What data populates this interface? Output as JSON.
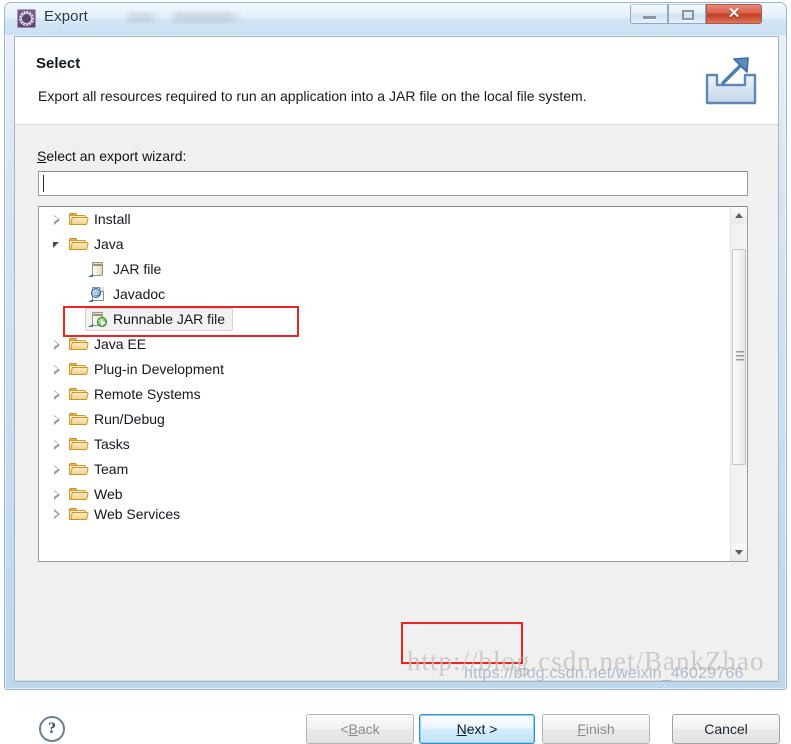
{
  "window": {
    "title": "Export",
    "icon": "eclipse-gear-icon",
    "controls": {
      "minimize": "minimize-button",
      "maximize": "maximize-button",
      "close": "✕"
    }
  },
  "header": {
    "title": "Select",
    "description": "Export all resources required to run an application into a JAR file on the local file system.",
    "icon": "export-wizard-icon"
  },
  "form": {
    "field_label_mnemonic": "S",
    "field_label_rest": "elect an export wizard:",
    "filter_value": "",
    "filter_placeholder": ""
  },
  "tree": {
    "items": [
      {
        "label": "Install",
        "level": 0,
        "icon": "folder-icon",
        "state": "collapsed",
        "selected": false,
        "clipped": false
      },
      {
        "label": "Java",
        "level": 0,
        "icon": "folder-icon",
        "state": "expanded",
        "selected": false,
        "clipped": false
      },
      {
        "label": "JAR file",
        "level": 1,
        "icon": "jar-file-icon",
        "state": "leaf",
        "selected": false,
        "clipped": false
      },
      {
        "label": "Javadoc",
        "level": 1,
        "icon": "javadoc-icon",
        "state": "leaf",
        "selected": false,
        "clipped": false
      },
      {
        "label": "Runnable JAR file",
        "level": 1,
        "icon": "runnable-jar-file-icon",
        "state": "leaf",
        "selected": true,
        "clipped": false
      },
      {
        "label": "Java EE",
        "level": 0,
        "icon": "folder-icon",
        "state": "collapsed",
        "selected": false,
        "clipped": false
      },
      {
        "label": "Plug-in Development",
        "level": 0,
        "icon": "folder-icon",
        "state": "collapsed",
        "selected": false,
        "clipped": false
      },
      {
        "label": "Remote Systems",
        "level": 0,
        "icon": "folder-icon",
        "state": "collapsed",
        "selected": false,
        "clipped": false
      },
      {
        "label": "Run/Debug",
        "level": 0,
        "icon": "folder-icon",
        "state": "collapsed",
        "selected": false,
        "clipped": false
      },
      {
        "label": "Tasks",
        "level": 0,
        "icon": "folder-icon",
        "state": "collapsed",
        "selected": false,
        "clipped": false
      },
      {
        "label": "Team",
        "level": 0,
        "icon": "folder-icon",
        "state": "collapsed",
        "selected": false,
        "clipped": false
      },
      {
        "label": "Web",
        "level": 0,
        "icon": "folder-icon",
        "state": "collapsed",
        "selected": false,
        "clipped": false
      },
      {
        "label": "Web Services",
        "level": 0,
        "icon": "folder-icon",
        "state": "collapsed",
        "selected": false,
        "clipped": true
      }
    ],
    "scrollbar": {
      "up_arrow": "scroll-up-arrow",
      "down_arrow": "scroll-down-arrow",
      "thumb": "scroll-thumb"
    }
  },
  "buttons": {
    "help": "?",
    "back": {
      "mnemonic": "B",
      "before": "< ",
      "after": "ack",
      "enabled": false
    },
    "next": {
      "mnemonic": "N",
      "before": "",
      "after": "ext >",
      "enabled": true
    },
    "finish": {
      "mnemonic": "F",
      "before": "",
      "after": "inish",
      "enabled": false
    },
    "cancel": {
      "label": "Cancel",
      "enabled": true
    }
  },
  "annotations": {
    "tree_highlight": "red-box-around-runnable-jar-file",
    "next_highlight": "red-box-around-next-button"
  },
  "watermarks": {
    "primary": "http://blog.csdn.net/BankZhao",
    "secondary": "https://blog.csdn.net/weixin_46029766"
  },
  "colors": {
    "accent_blue": "#2f8fd0",
    "annotation_red": "#f02323",
    "title_bar": "#d2e5f5",
    "folder_orange": "#f0b64a",
    "close_red": "#c33c20"
  }
}
